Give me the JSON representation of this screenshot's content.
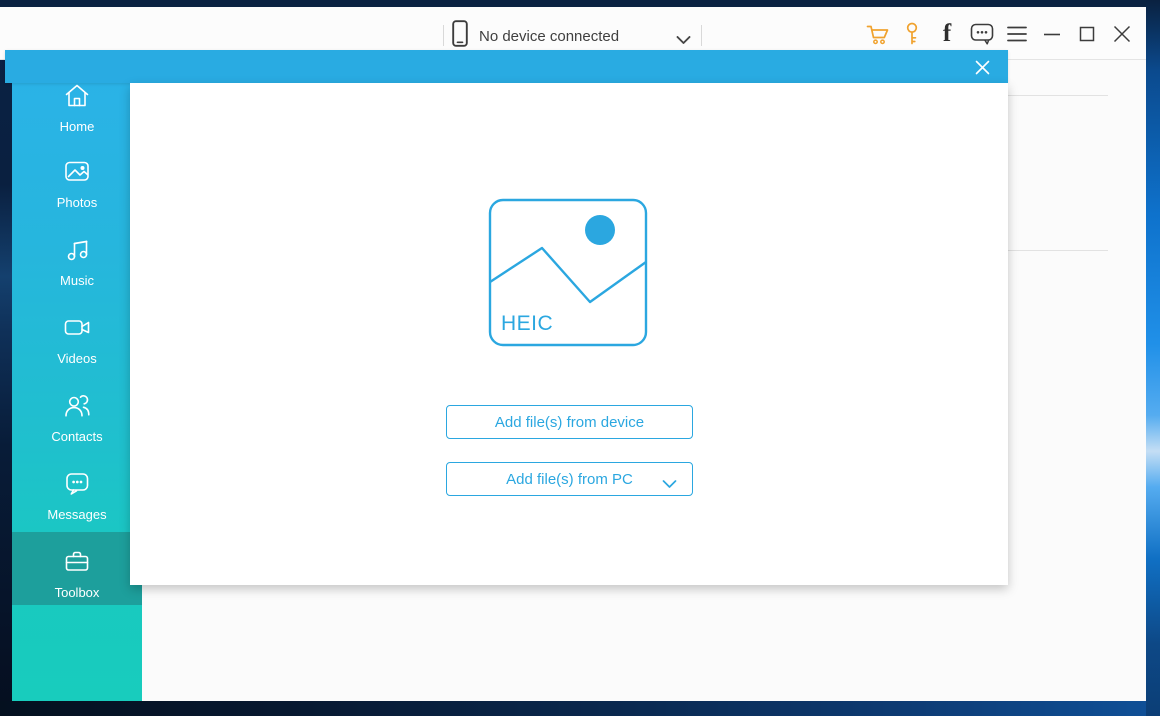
{
  "toolbar": {
    "device": {
      "icon": "phone-icon",
      "label": "No device connected",
      "chevron": "chevron-down-icon"
    },
    "icons": [
      {
        "name": "cart-icon"
      },
      {
        "name": "key-icon"
      },
      {
        "name": "facebook-icon",
        "glyph": "f"
      },
      {
        "name": "feedback-icon"
      },
      {
        "name": "menu-icon"
      },
      {
        "name": "minimize-icon"
      },
      {
        "name": "maximize-icon"
      },
      {
        "name": "close-icon"
      }
    ]
  },
  "sidebar": {
    "items": [
      {
        "label": "Home",
        "icon": "home-icon",
        "selected": false
      },
      {
        "label": "Photos",
        "icon": "photos-icon",
        "selected": false
      },
      {
        "label": "Music",
        "icon": "music-icon",
        "selected": false
      },
      {
        "label": "Videos",
        "icon": "videos-icon",
        "selected": false
      },
      {
        "label": "Contacts",
        "icon": "contacts-icon",
        "selected": false
      },
      {
        "label": "Messages",
        "icon": "messages-icon",
        "selected": false
      },
      {
        "label": "Toolbox",
        "icon": "toolbox-icon",
        "selected": true
      }
    ]
  },
  "popup": {
    "close_icon": "close-icon",
    "heic_label": "HEIC",
    "buttons": [
      {
        "label": "Add file(s) from device",
        "dropdown": false
      },
      {
        "label": "Add file(s) from PC",
        "dropdown": true
      }
    ]
  },
  "colors": {
    "accent_blue": "#2ba7e0",
    "popup_header_blue": "#29abe2",
    "sidebar_top": "#2bb2e8",
    "sidebar_bottom": "#18ccbd",
    "selected_item_teal": "#1d9f9c",
    "icon_orange": "#f0a22e"
  }
}
